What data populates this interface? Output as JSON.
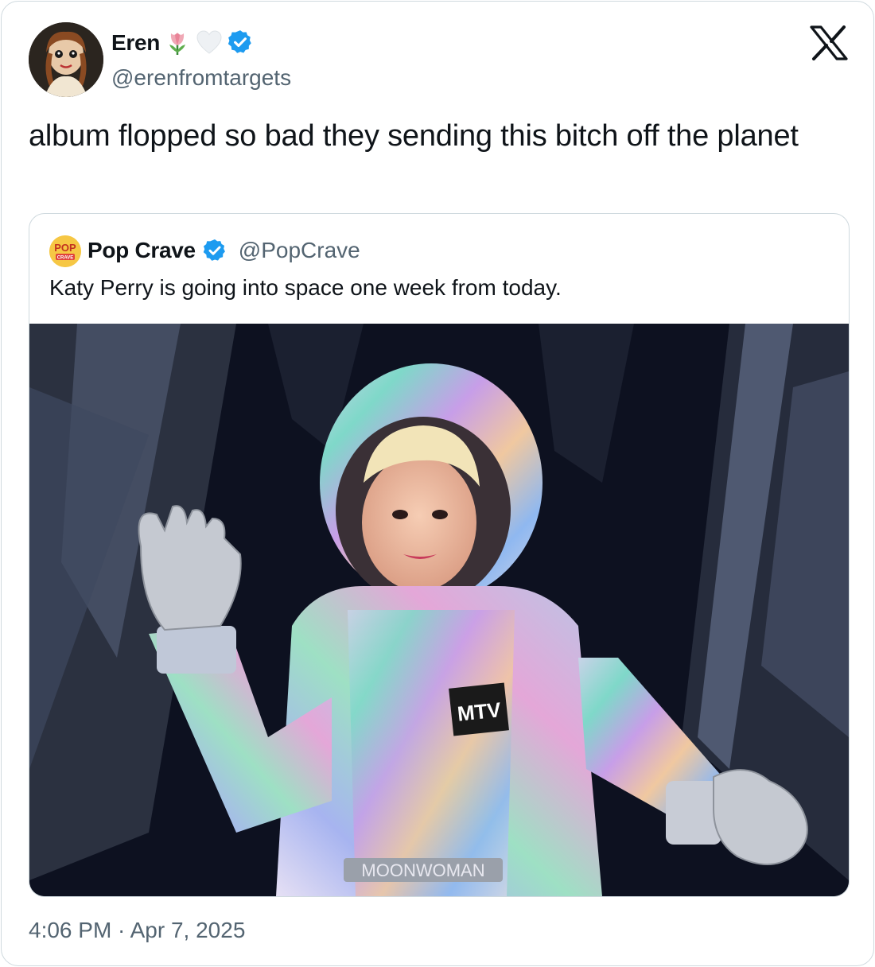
{
  "tweet": {
    "author": {
      "display_name": "Eren",
      "name_emojis": [
        "tulip-icon",
        "white-heart-icon"
      ],
      "verified": true,
      "handle": "@erenfromtargets"
    },
    "text": "album flopped so bad they sending this bitch off the planet",
    "timestamp": "4:06 PM · Apr 7, 2025",
    "platform_icon": "x-logo-icon"
  },
  "quote": {
    "author": {
      "avatar_text_top": "POP",
      "avatar_text_bottom": "CRAVE",
      "display_name": "Pop Crave",
      "verified": true,
      "handle": "@PopCrave"
    },
    "text": "Katy Perry is going into space one week from today.",
    "media": {
      "image_text": [
        "MTV",
        "MOONWOMAN"
      ]
    }
  },
  "colors": {
    "text_primary": "#0f1419",
    "text_secondary": "#536471",
    "verified_blue": "#1d9bf0",
    "border": "#cfd9de"
  }
}
